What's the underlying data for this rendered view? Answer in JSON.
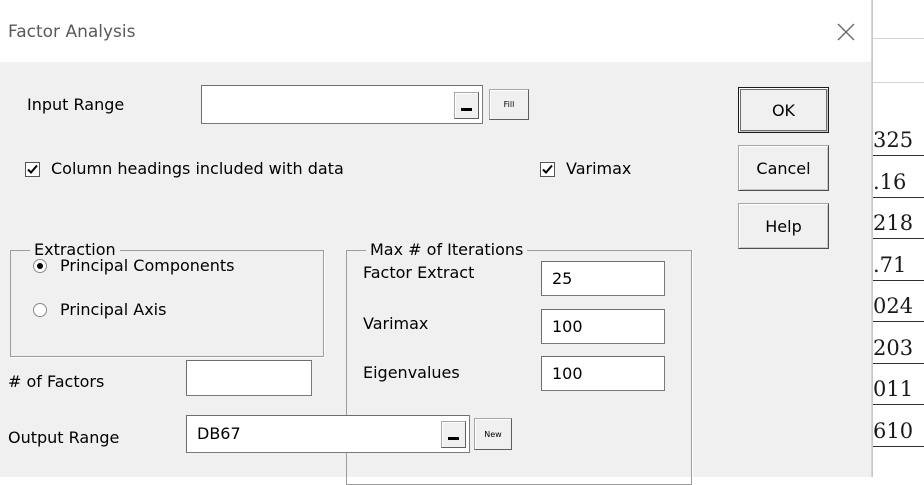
{
  "window": {
    "title": "Factor Analysis",
    "close_icon": "close-icon"
  },
  "input_range": {
    "label": "Input Range",
    "value": "",
    "collapse_icon": "collapse-dash-icon",
    "fill_label": "Fill"
  },
  "options": {
    "column_headings": {
      "label": "Column headings included with data",
      "checked": true
    },
    "varimax": {
      "label": "Varimax",
      "checked": true
    }
  },
  "extraction": {
    "title": "Extraction",
    "options": [
      {
        "label": "Principal Components",
        "selected": true
      },
      {
        "label": "Principal Axis",
        "selected": false
      }
    ]
  },
  "iterations": {
    "title": "Max # of Iterations",
    "rows": [
      {
        "label": "Factor Extract",
        "value": "25"
      },
      {
        "label": "Varimax",
        "value": "100"
      },
      {
        "label": "Eigenvalues",
        "value": "100"
      }
    ]
  },
  "num_factors": {
    "label": "# of Factors",
    "value": ""
  },
  "output_range": {
    "label": "Output Range",
    "value": "DB67",
    "collapse_icon": "collapse-dash-icon",
    "new_label": "New"
  },
  "buttons": {
    "ok": "OK",
    "cancel": "Cancel",
    "help": "Help"
  },
  "background_sheet": {
    "cells": [
      "325",
      ".16",
      "218",
      ".71",
      "024",
      "203",
      "011",
      "610"
    ]
  }
}
